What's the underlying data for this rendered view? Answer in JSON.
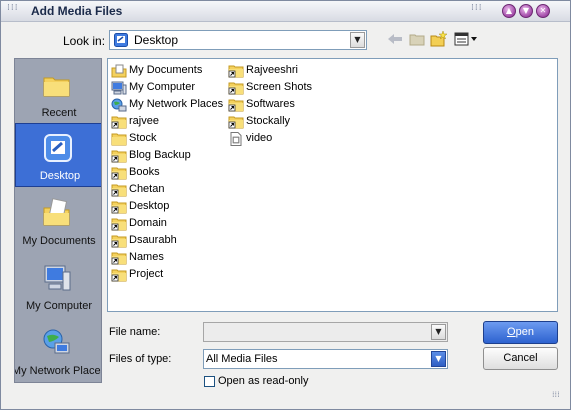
{
  "window": {
    "title": "Add Media Files"
  },
  "lookin": {
    "label": "Look in:",
    "value": "Desktop"
  },
  "places": [
    {
      "label": "Recent",
      "icon": "recent-folder-icon",
      "selected": false
    },
    {
      "label": "Desktop",
      "icon": "desktop-icon",
      "selected": true
    },
    {
      "label": "My Documents",
      "icon": "my-documents-icon",
      "selected": false
    },
    {
      "label": "My Computer",
      "icon": "my-computer-icon",
      "selected": false
    },
    {
      "label": "My Network Places",
      "icon": "network-places-icon",
      "selected": false
    }
  ],
  "files": {
    "column1": [
      {
        "name": "My Documents",
        "icon": "my-documents-icon"
      },
      {
        "name": "My Computer",
        "icon": "my-computer-icon"
      },
      {
        "name": "My Network Places",
        "icon": "network-places-icon"
      },
      {
        "name": "rajvee",
        "icon": "folder-shortcut-icon"
      },
      {
        "name": "Stock",
        "icon": "folder-icon"
      },
      {
        "name": "Blog Backup",
        "icon": "folder-shortcut-icon"
      },
      {
        "name": "Books",
        "icon": "folder-shortcut-icon"
      },
      {
        "name": "Chetan",
        "icon": "folder-shortcut-icon"
      },
      {
        "name": "Desktop",
        "icon": "folder-shortcut-icon"
      },
      {
        "name": "Domain",
        "icon": "folder-shortcut-icon"
      },
      {
        "name": "Dsaurabh",
        "icon": "folder-shortcut-icon"
      },
      {
        "name": "Names",
        "icon": "folder-shortcut-icon"
      },
      {
        "name": "Project",
        "icon": "folder-shortcut-icon"
      }
    ],
    "column2": [
      {
        "name": "Rajveeshri",
        "icon": "folder-shortcut-icon"
      },
      {
        "name": "Screen Shots",
        "icon": "folder-shortcut-icon"
      },
      {
        "name": "Softwares",
        "icon": "folder-shortcut-icon"
      },
      {
        "name": "Stockally",
        "icon": "folder-shortcut-icon"
      },
      {
        "name": "video",
        "icon": "video-file-icon"
      }
    ]
  },
  "filename": {
    "label": "File name:",
    "value": ""
  },
  "filetype": {
    "label": "Files of type:",
    "value": "All Media Files"
  },
  "readonly": {
    "label": "Open as read-only",
    "checked": false
  },
  "buttons": {
    "open": "Open",
    "cancel": "Cancel"
  },
  "colors": {
    "selection": "#3d6fd6",
    "places_bg": "#9da4b3",
    "title_button": "#a24aa8"
  }
}
